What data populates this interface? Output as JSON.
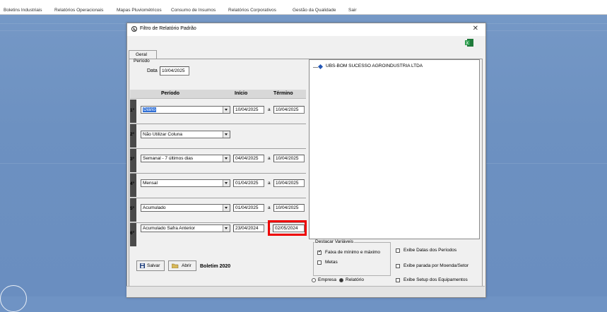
{
  "menu": {
    "items": [
      "Boletins Industriais",
      "Relatórios Operacionais",
      "Mapas Pluviométricos",
      "Consumo de Insumos",
      "Relatórios Corporativos",
      "Gestão da Qualidade",
      "Sair"
    ]
  },
  "dialog": {
    "title": "Filtro de Relatório Padrão",
    "tab": "Geral",
    "periodo_legend": "Período",
    "data_label": "Data",
    "data_value": "10/04/2025",
    "headers": {
      "periodo": "Período",
      "inicio": "Início",
      "termino": "Término"
    },
    "a_sep": "a",
    "rows": [
      {
        "num": "1º",
        "option": "Diário",
        "inicio": "10/04/2025",
        "termino": "10/04/2025"
      },
      {
        "num": "2º",
        "option": "Não Utilizar Coluna",
        "inicio": "",
        "termino": ""
      },
      {
        "num": "3º",
        "option": "Semanal - 7 últimos dias",
        "inicio": "04/04/2025",
        "termino": "10/04/2025"
      },
      {
        "num": "4º",
        "option": "Mensal",
        "inicio": "01/04/2025",
        "termino": "10/04/2025"
      },
      {
        "num": "5º",
        "option": "Acumulado",
        "inicio": "01/04/2025",
        "termino": "10/04/2025"
      },
      {
        "num": "6º",
        "option": "Acumulado Safra Anterior",
        "inicio": "23/04/2024",
        "termino": "02/05/2024"
      }
    ],
    "tree_item": "UBS-BOM SUCESSO AGROINDUSTRIA LTDA",
    "destacar": {
      "legend": "Destacar Variáveis",
      "faixa": "Faixa de mínimo e máximo",
      "metas": "Metas"
    },
    "options": {
      "datas": "Exibe Datas dos Períodos",
      "parada": "Exibe parada por Moenda/Setor",
      "setup": "Exibe Setup dos Equipamentos"
    },
    "radios": {
      "empresa": "Empresa",
      "relatorio": "Relatório"
    },
    "buttons": {
      "salvar": "Salvar",
      "abrir": "Abrir"
    },
    "boletim": "Boletim 2020"
  }
}
